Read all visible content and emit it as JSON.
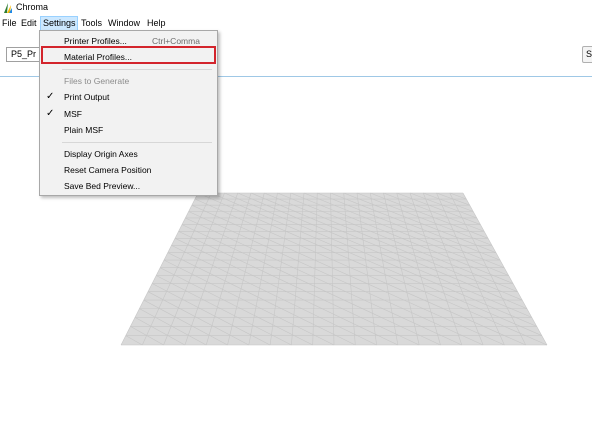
{
  "app": {
    "title": "Chroma"
  },
  "menubar": {
    "items": [
      {
        "label": "File"
      },
      {
        "label": "Edit"
      },
      {
        "label": "Settings"
      },
      {
        "label": "Tools"
      },
      {
        "label": "Window"
      },
      {
        "label": "Help"
      }
    ],
    "active": "Settings"
  },
  "toolbar": {
    "profile_select_value": "P5_Pr",
    "right_button_label": "S"
  },
  "settings_menu": {
    "items": [
      {
        "label": "Printer Profiles...",
        "shortcut": "Ctrl+Comma",
        "enabled": true,
        "checked": false
      },
      {
        "label": "Material Profiles...",
        "shortcut": "",
        "enabled": true,
        "checked": false,
        "highlighted": true
      },
      {
        "label": "Files to Generate",
        "shortcut": "",
        "enabled": false,
        "checked": false
      },
      {
        "label": "Print Output",
        "shortcut": "",
        "enabled": true,
        "checked": true
      },
      {
        "label": "MSF",
        "shortcut": "",
        "enabled": true,
        "checked": true
      },
      {
        "label": "Plain MSF",
        "shortcut": "",
        "enabled": true,
        "checked": false
      },
      {
        "label": "Display Origin Axes",
        "shortcut": "",
        "enabled": true,
        "checked": false
      },
      {
        "label": "Reset Camera Position",
        "shortcut": "",
        "enabled": true,
        "checked": false
      },
      {
        "label": "Save Bed Preview...",
        "shortcut": "",
        "enabled": true,
        "checked": false
      }
    ],
    "check_glyph": "✓"
  },
  "viewport": {
    "bed_fill": "#d9d9d9",
    "grid_color": "#c4c4c4"
  },
  "colors": {
    "highlight_box": "#d3242c",
    "menu_active": "#cce8ff"
  }
}
